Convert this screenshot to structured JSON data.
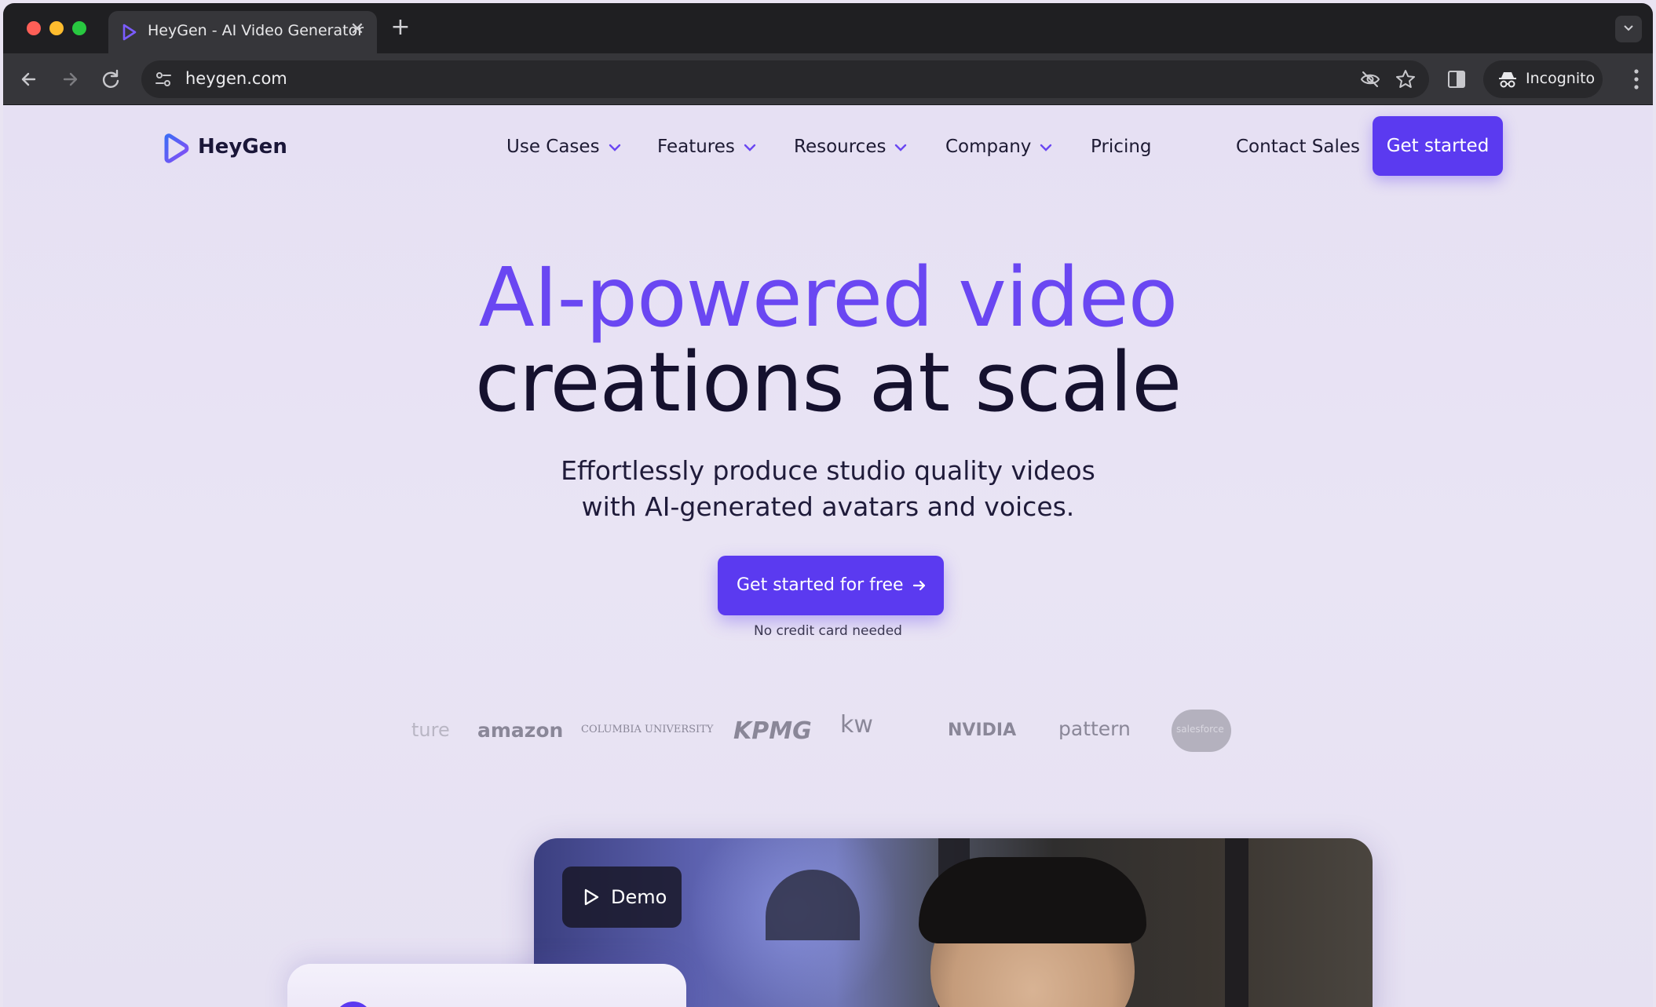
{
  "browser": {
    "tab_title": "HeyGen - AI Video Generator",
    "url": "heygen.com",
    "incognito_label": "Incognito"
  },
  "header": {
    "brand": "HeyGen",
    "nav": [
      {
        "label": "Use Cases",
        "has_dropdown": true
      },
      {
        "label": "Features",
        "has_dropdown": true
      },
      {
        "label": "Resources",
        "has_dropdown": true
      },
      {
        "label": "Company",
        "has_dropdown": true
      },
      {
        "label": "Pricing",
        "has_dropdown": false
      }
    ],
    "contact_label": "Contact Sales",
    "cta_label": "Get started"
  },
  "hero": {
    "title_line1": "AI-powered video",
    "title_line2": "creations at scale",
    "subtitle_line1": "Effortlessly produce studio quality videos",
    "subtitle_line2": "with AI-generated avatars and voices.",
    "cta_label": "Get started for free",
    "note": "No credit card needed"
  },
  "logos": [
    "ture",
    "amazon",
    "COLUMBIA UNIVERSITY",
    "KPMG",
    "kw",
    "NVIDIA",
    "pattern",
    "salesforce"
  ],
  "demo": {
    "badge_label": "Demo"
  },
  "colors": {
    "brand_purple": "#5b3af0",
    "headline_purple": "#6a47f2",
    "headline_dark": "#15112e"
  },
  "icons": [
    "heygen-logo-icon",
    "close-icon",
    "plus-icon",
    "back-icon",
    "forward-icon",
    "reload-icon",
    "site-info-icon",
    "eye-off-icon",
    "star-icon",
    "side-panel-icon",
    "incognito-icon",
    "kebab-menu-icon",
    "chevron-down-icon",
    "arrow-right-icon",
    "play-icon"
  ]
}
